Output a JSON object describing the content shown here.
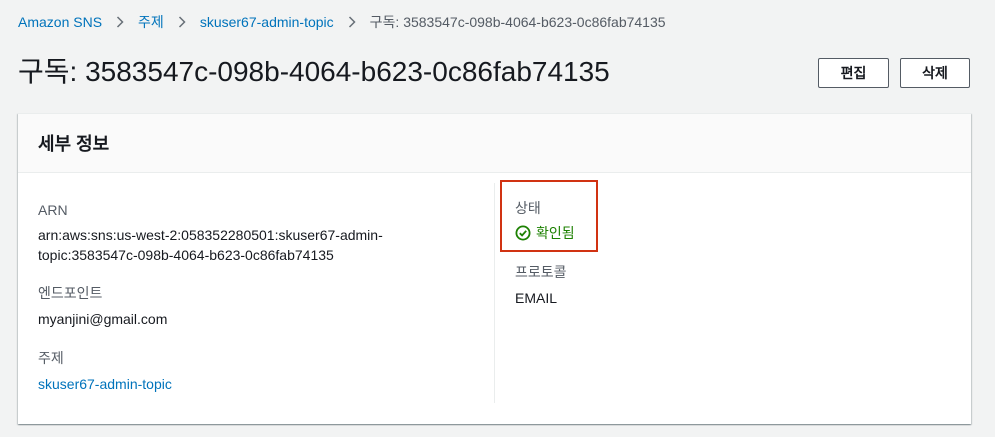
{
  "breadcrumb": {
    "items": [
      "Amazon SNS",
      "주제",
      "skuser67-admin-topic"
    ],
    "current": "구독: 3583547c-098b-4064-b623-0c86fab74135"
  },
  "page": {
    "title": "구독: 3583547c-098b-4064-b623-0c86fab74135"
  },
  "actions": {
    "edit_label": "편집",
    "delete_label": "삭제"
  },
  "details": {
    "header": "세부 정보",
    "arn_label": "ARN",
    "arn_line1": "arn:aws:sns:us-west-2:058352280501:skuser67-admin-",
    "arn_line2": "topic:3583547c-098b-4064-b623-0c86fab74135",
    "endpoint_label": "엔드포인트",
    "endpoint_value": "myanjini@gmail.com",
    "topic_label": "주제",
    "topic_value": "skuser67-admin-topic",
    "status_label": "상태",
    "status_value": "확인됨",
    "protocol_label": "프로토콜",
    "protocol_value": "EMAIL"
  },
  "colors": {
    "link": "#0073bb",
    "success": "#1d8102",
    "highlight": "#d13212"
  },
  "icons": {
    "separator": "chevron-right-icon",
    "status": "check-circle-icon"
  }
}
